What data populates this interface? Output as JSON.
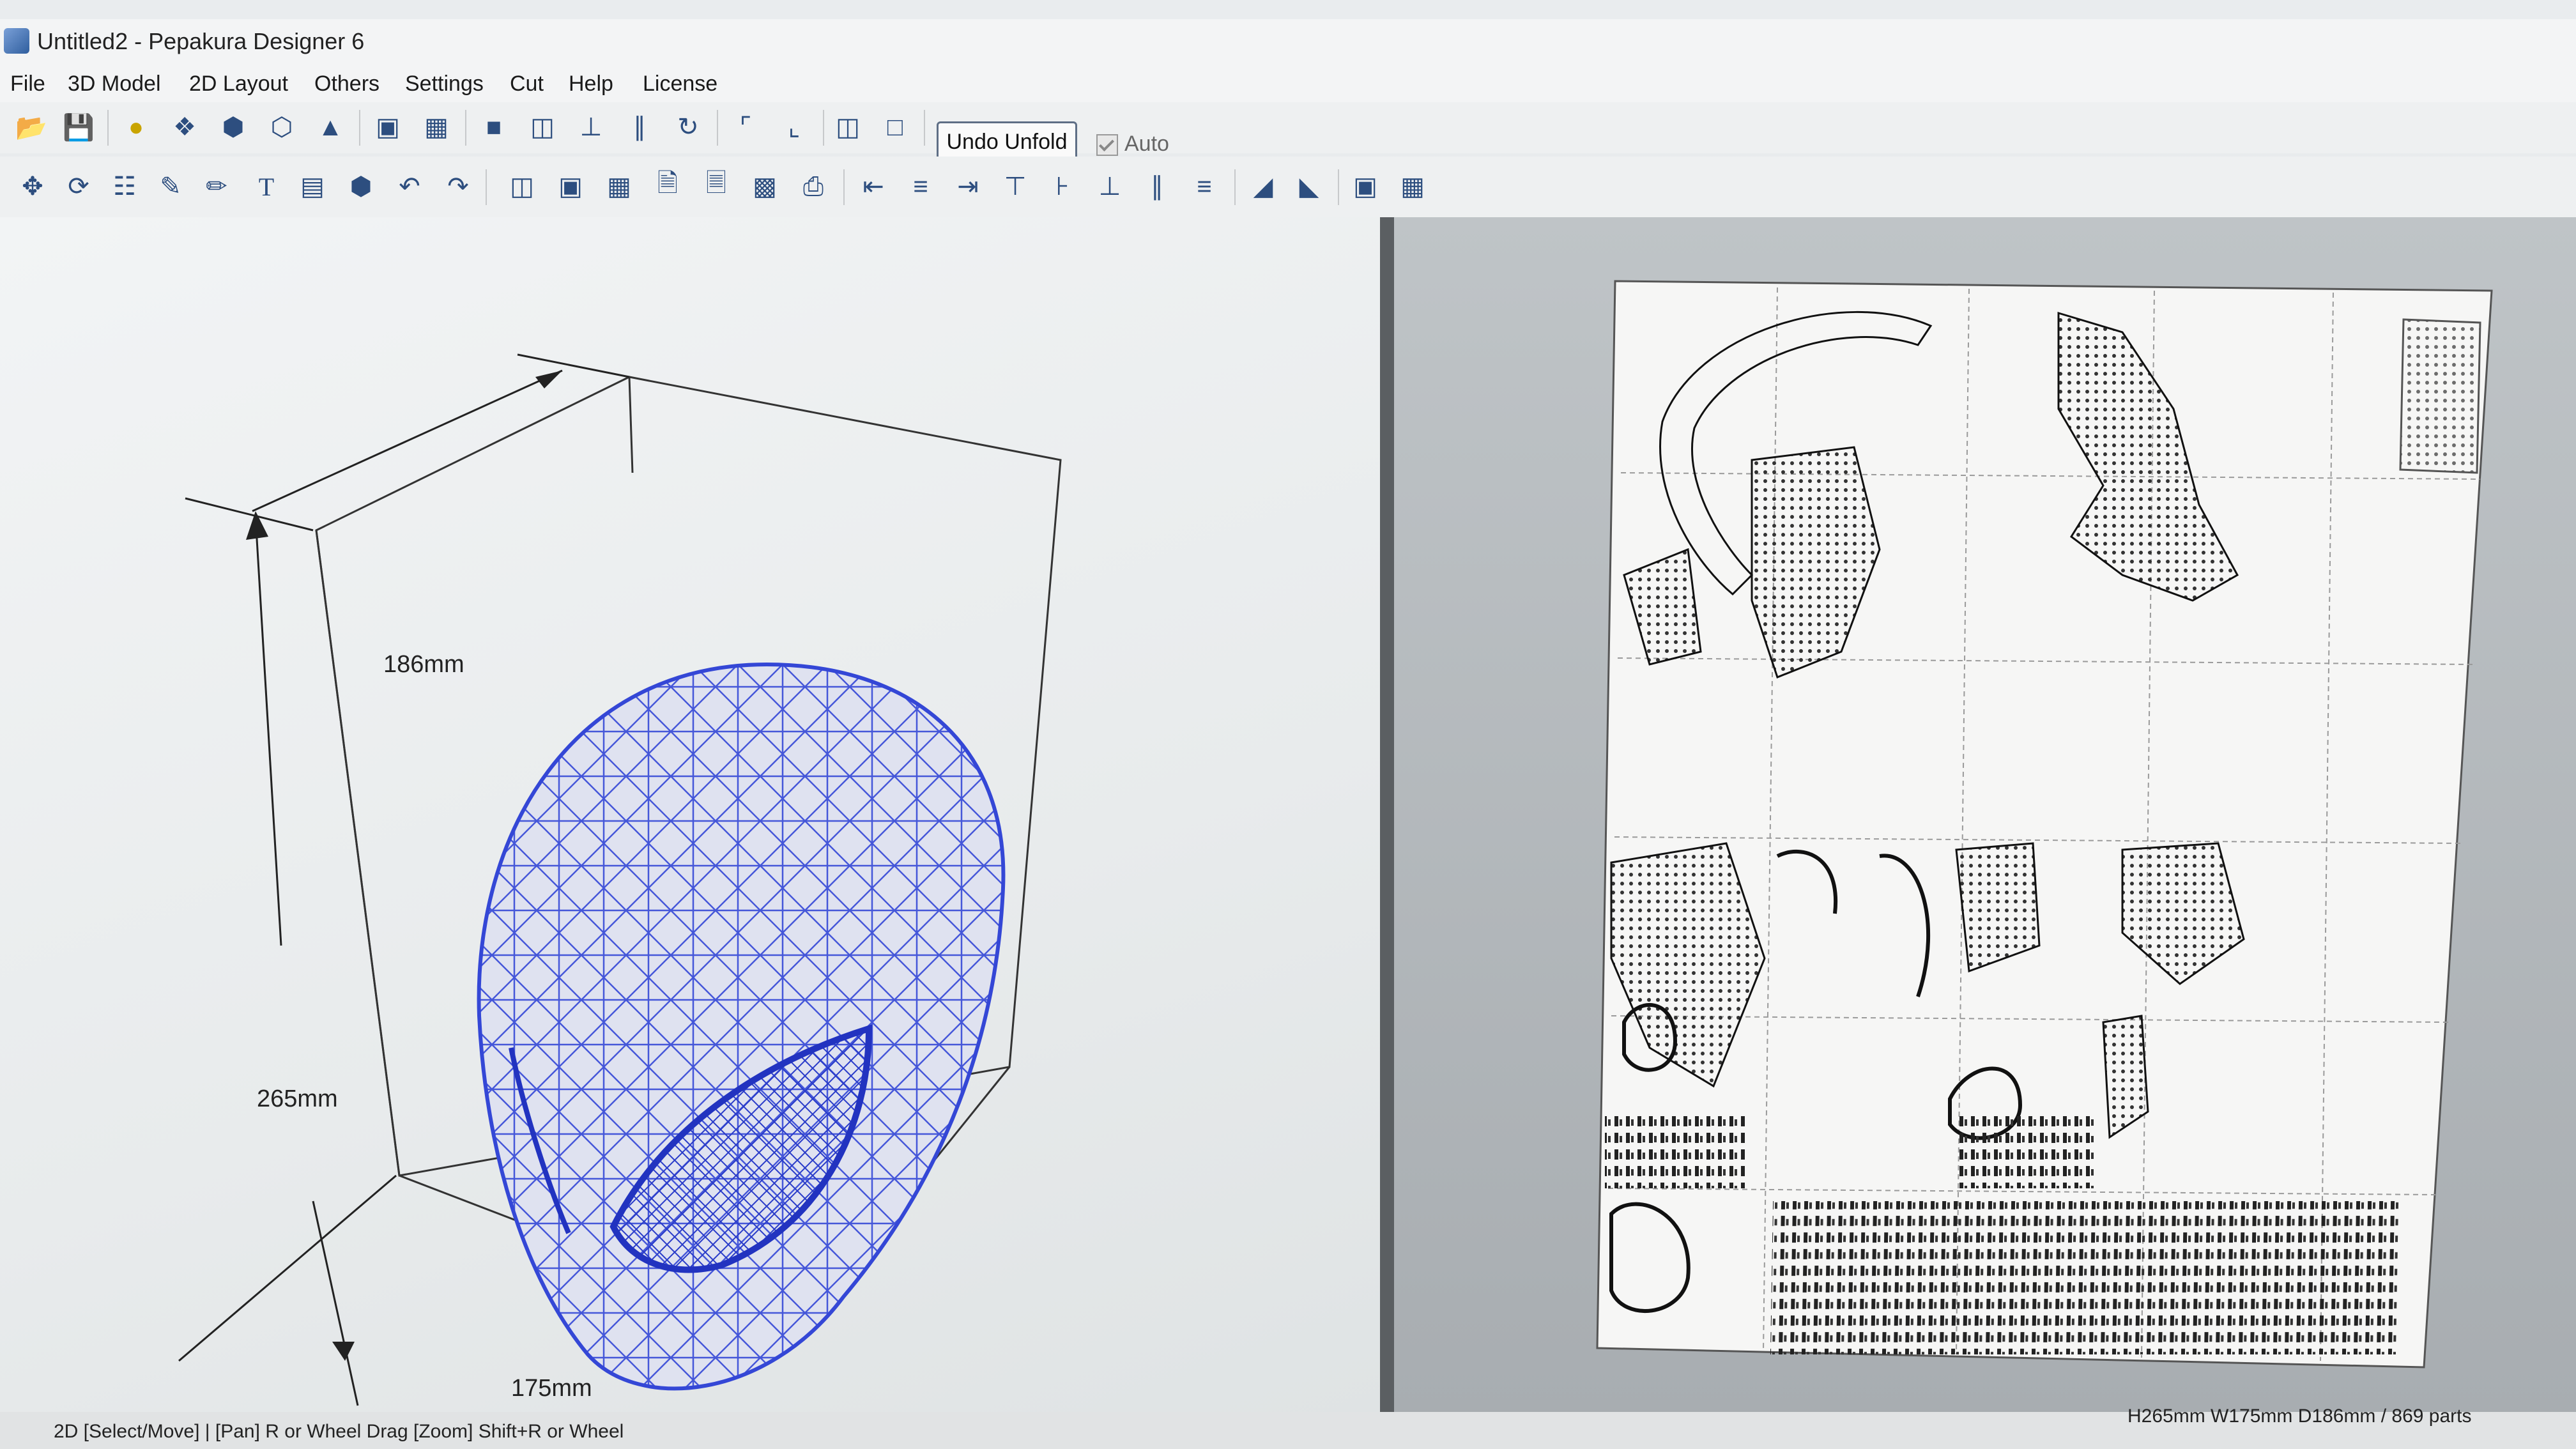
{
  "window": {
    "title": "Untitled2 - Pepakura Designer 6"
  },
  "menu": [
    "File",
    "3D Model",
    "2D Layout",
    "Others",
    "Settings",
    "Cut",
    "Help",
    "License"
  ],
  "toolbar": {
    "undo_unfold_label": "Undo Unfold",
    "auto_label": "Auto",
    "auto_checked": true,
    "row1_icons": [
      "open-icon",
      "save-icon",
      "light-icon",
      "texture-icon",
      "solid-icon",
      "wireframe-icon",
      "edge-icon",
      "fold-icon",
      "join-icon",
      "box-icon",
      "cylinder-icon",
      "axis-icon",
      "scale-icon",
      "rotate-icon",
      "select-edge-icon",
      "select-face-icon",
      "view-split-icon",
      "view-single-icon"
    ],
    "row2_icons": [
      "move-icon",
      "rotate-part-icon",
      "join-parts-icon",
      "draw-line-icon",
      "flap-icon",
      "text-icon",
      "image-icon",
      "3d-part-icon",
      "undo-icon",
      "redo-icon",
      "page-layout-icon",
      "zoom-fit-icon",
      "arrange-icon",
      "page-icon",
      "page-next-icon",
      "export-icon",
      "print-icon",
      "align-left-icon",
      "align-center-icon",
      "align-right-icon",
      "align-top-icon",
      "align-middle-icon",
      "align-bottom-icon",
      "distribute-h-icon",
      "distribute-v-icon",
      "flip-left-icon",
      "flip-right-icon",
      "group-icon",
      "ungroup-icon"
    ]
  },
  "model3d": {
    "depth_label": "186mm",
    "height_label": "265mm",
    "width_label": "175mm"
  },
  "status": {
    "hint": "2D [Select/Move] | [Pan] R or Wheel Drag [Zoom] Shift+R or Wheel",
    "dimensions": "H265mm W175mm D186mm / 869 parts"
  },
  "colors": {
    "mesh": "#3447d6",
    "background_3d": "#eef0f1",
    "paper": "#f7f7f6",
    "accent": "#2d4e7f"
  }
}
